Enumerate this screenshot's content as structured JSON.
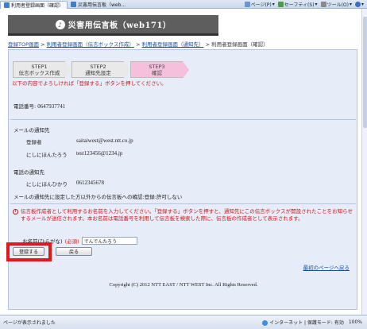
{
  "browser": {
    "tabs": [
      {
        "label": "利用者登録画面（確認）"
      },
      {
        "label": "災害用伝言板（web..."
      }
    ],
    "commands": [
      {
        "label": "ページ(P)",
        "icon": "page-icon"
      },
      {
        "label": "セーフティ(S)",
        "icon": "safety-icon"
      },
      {
        "label": "ツール(O)",
        "icon": "tools-icon"
      },
      {
        "label": "",
        "icon": "help-icon"
      }
    ]
  },
  "header": {
    "title": "災害用伝言板（web171）",
    "badge": "♪"
  },
  "breadcrumb": {
    "items": [
      {
        "label": "登録TOP画面",
        "link": true
      },
      {
        "label": "利用者登録画面（伝言ボックス作成）",
        "link": true
      },
      {
        "label": "利用者登録画面（通知先）",
        "link": true
      },
      {
        "label": "利用者登録画面（確認）",
        "link": false
      }
    ],
    "separator": " > "
  },
  "steps": [
    {
      "line1": "STEP1",
      "line2": "伝言ボックス作成",
      "current": false
    },
    {
      "line1": "STEP2",
      "line2": "通知先設定",
      "current": false
    },
    {
      "line1": "STEP3",
      "line2": "確認",
      "current": true
    }
  ],
  "notice": "以下の内容でよろしければ「登録する」ボタンを押してください。",
  "phone": {
    "label": "電話番号: ",
    "value": "0647937741"
  },
  "mail": {
    "heading": "メールの通知先",
    "rows": [
      {
        "name": "登録者",
        "value": "saitaiwest@west.ntt.co.jp"
      },
      {
        "name": "にしにほんたろう",
        "value": "test123456@1234.jp"
      }
    ]
  },
  "tel": {
    "heading": "電話の通知先",
    "rows": [
      {
        "name": "にしにほんひかり",
        "value": "0612345678"
      }
    ]
  },
  "confirmation": {
    "label": "メールの通知先に設定した方以外からの伝言板への確認:",
    "value": "登録:許可しない"
  },
  "warning": {
    "icon": "!",
    "text": "伝言板作成者として利用するお名前を入力してください。「登録する」ボタンを押すと、通知先にこの伝言ボックスが開設されたことをお知らせするメールが送信されます。本お名前は電話番号を利用して伝言板を検索した際に、伝言板の作成者として表示されます。"
  },
  "nameField": {
    "label": "お名前(ひらがな)",
    "required": "(必須)",
    "value": "でんでんたろう"
  },
  "buttons": {
    "register": "登録する",
    "back": "戻る"
  },
  "toplink": "最初のページへ戻る",
  "copyright": "Copyright (C) 2012 NTT EAST / NTT WEST Inc. All Rights Reserved.",
  "status": {
    "left": "ページが表示されました",
    "zone": "インターネット | 保護モード: 有効",
    "zoom": "100%"
  }
}
